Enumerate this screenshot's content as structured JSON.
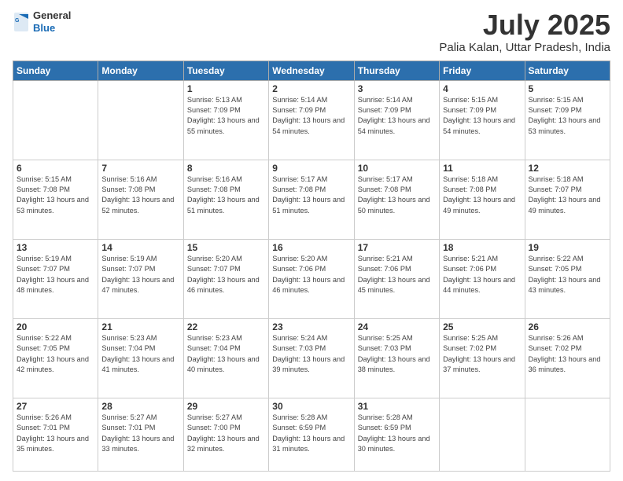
{
  "header": {
    "logo": {
      "general": "General",
      "blue": "Blue"
    },
    "title": "July 2025",
    "subtitle": "Palia Kalan, Uttar Pradesh, India"
  },
  "weekdays": [
    "Sunday",
    "Monday",
    "Tuesday",
    "Wednesday",
    "Thursday",
    "Friday",
    "Saturday"
  ],
  "weeks": [
    [
      null,
      null,
      {
        "day": 1,
        "sunrise": "5:13 AM",
        "sunset": "7:09 PM",
        "daylight": "13 hours and 55 minutes."
      },
      {
        "day": 2,
        "sunrise": "5:14 AM",
        "sunset": "7:09 PM",
        "daylight": "13 hours and 54 minutes."
      },
      {
        "day": 3,
        "sunrise": "5:14 AM",
        "sunset": "7:09 PM",
        "daylight": "13 hours and 54 minutes."
      },
      {
        "day": 4,
        "sunrise": "5:15 AM",
        "sunset": "7:09 PM",
        "daylight": "13 hours and 54 minutes."
      },
      {
        "day": 5,
        "sunrise": "5:15 AM",
        "sunset": "7:09 PM",
        "daylight": "13 hours and 53 minutes."
      }
    ],
    [
      {
        "day": 6,
        "sunrise": "5:15 AM",
        "sunset": "7:08 PM",
        "daylight": "13 hours and 53 minutes."
      },
      {
        "day": 7,
        "sunrise": "5:16 AM",
        "sunset": "7:08 PM",
        "daylight": "13 hours and 52 minutes."
      },
      {
        "day": 8,
        "sunrise": "5:16 AM",
        "sunset": "7:08 PM",
        "daylight": "13 hours and 51 minutes."
      },
      {
        "day": 9,
        "sunrise": "5:17 AM",
        "sunset": "7:08 PM",
        "daylight": "13 hours and 51 minutes."
      },
      {
        "day": 10,
        "sunrise": "5:17 AM",
        "sunset": "7:08 PM",
        "daylight": "13 hours and 50 minutes."
      },
      {
        "day": 11,
        "sunrise": "5:18 AM",
        "sunset": "7:08 PM",
        "daylight": "13 hours and 49 minutes."
      },
      {
        "day": 12,
        "sunrise": "5:18 AM",
        "sunset": "7:07 PM",
        "daylight": "13 hours and 49 minutes."
      }
    ],
    [
      {
        "day": 13,
        "sunrise": "5:19 AM",
        "sunset": "7:07 PM",
        "daylight": "13 hours and 48 minutes."
      },
      {
        "day": 14,
        "sunrise": "5:19 AM",
        "sunset": "7:07 PM",
        "daylight": "13 hours and 47 minutes."
      },
      {
        "day": 15,
        "sunrise": "5:20 AM",
        "sunset": "7:07 PM",
        "daylight": "13 hours and 46 minutes."
      },
      {
        "day": 16,
        "sunrise": "5:20 AM",
        "sunset": "7:06 PM",
        "daylight": "13 hours and 46 minutes."
      },
      {
        "day": 17,
        "sunrise": "5:21 AM",
        "sunset": "7:06 PM",
        "daylight": "13 hours and 45 minutes."
      },
      {
        "day": 18,
        "sunrise": "5:21 AM",
        "sunset": "7:06 PM",
        "daylight": "13 hours and 44 minutes."
      },
      {
        "day": 19,
        "sunrise": "5:22 AM",
        "sunset": "7:05 PM",
        "daylight": "13 hours and 43 minutes."
      }
    ],
    [
      {
        "day": 20,
        "sunrise": "5:22 AM",
        "sunset": "7:05 PM",
        "daylight": "13 hours and 42 minutes."
      },
      {
        "day": 21,
        "sunrise": "5:23 AM",
        "sunset": "7:04 PM",
        "daylight": "13 hours and 41 minutes."
      },
      {
        "day": 22,
        "sunrise": "5:23 AM",
        "sunset": "7:04 PM",
        "daylight": "13 hours and 40 minutes."
      },
      {
        "day": 23,
        "sunrise": "5:24 AM",
        "sunset": "7:03 PM",
        "daylight": "13 hours and 39 minutes."
      },
      {
        "day": 24,
        "sunrise": "5:25 AM",
        "sunset": "7:03 PM",
        "daylight": "13 hours and 38 minutes."
      },
      {
        "day": 25,
        "sunrise": "5:25 AM",
        "sunset": "7:02 PM",
        "daylight": "13 hours and 37 minutes."
      },
      {
        "day": 26,
        "sunrise": "5:26 AM",
        "sunset": "7:02 PM",
        "daylight": "13 hours and 36 minutes."
      }
    ],
    [
      {
        "day": 27,
        "sunrise": "5:26 AM",
        "sunset": "7:01 PM",
        "daylight": "13 hours and 35 minutes."
      },
      {
        "day": 28,
        "sunrise": "5:27 AM",
        "sunset": "7:01 PM",
        "daylight": "13 hours and 33 minutes."
      },
      {
        "day": 29,
        "sunrise": "5:27 AM",
        "sunset": "7:00 PM",
        "daylight": "13 hours and 32 minutes."
      },
      {
        "day": 30,
        "sunrise": "5:28 AM",
        "sunset": "6:59 PM",
        "daylight": "13 hours and 31 minutes."
      },
      {
        "day": 31,
        "sunrise": "5:28 AM",
        "sunset": "6:59 PM",
        "daylight": "13 hours and 30 minutes."
      },
      null,
      null
    ]
  ]
}
